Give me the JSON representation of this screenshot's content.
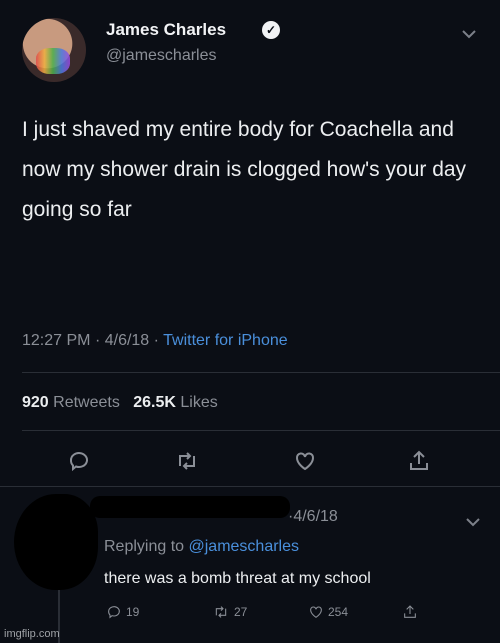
{
  "tweet": {
    "author_name": "James Charles",
    "author_handle": "@jamescharles",
    "text": "I just shaved my entire body for Coachella and now my shower drain is clogged how's your day going so far",
    "time": "12:27 PM",
    "date": "4/6/18",
    "source": "Twitter for iPhone",
    "retweets_count": "920",
    "retweets_label": "Retweets",
    "likes_count": "26.5K",
    "likes_label": "Likes"
  },
  "reply": {
    "date": "4/6/18",
    "replying_prefix": "Replying to",
    "replying_to": "@jamescharles",
    "text": "there was a bomb threat at my school",
    "reply_count": "19",
    "retweet_count": "27",
    "like_count": "254"
  },
  "watermark": "imgflip.com",
  "colors": {
    "background": "#0b0e15",
    "link": "#4a8fdb",
    "muted": "#8b8f97"
  }
}
